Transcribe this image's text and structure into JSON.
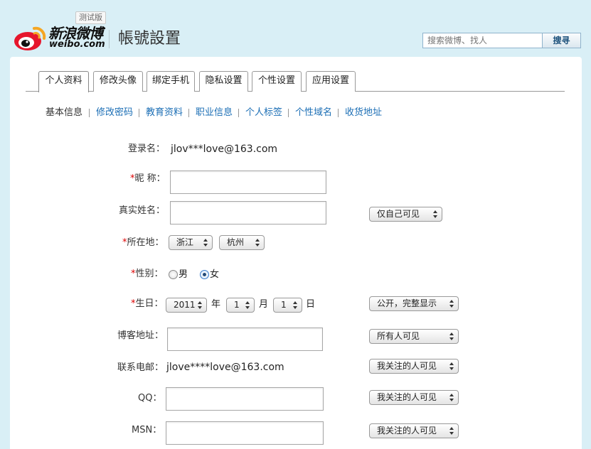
{
  "header": {
    "beta_badge": "测试版",
    "brand_cn": "新浪微博",
    "brand_en": "weibo.com",
    "page_title": "帳號設置",
    "search_placeholder": "搜索微博、找人",
    "search_button": "搜寻"
  },
  "tabs": [
    {
      "label": "个人资料",
      "active": true
    },
    {
      "label": "修改头像"
    },
    {
      "label": "绑定手机"
    },
    {
      "label": "隐私设置"
    },
    {
      "label": "个性设置"
    },
    {
      "label": "应用设置"
    }
  ],
  "subnav": [
    {
      "label": "基本信息",
      "current": true
    },
    {
      "label": "修改密码"
    },
    {
      "label": "教育资料"
    },
    {
      "label": "职业信息"
    },
    {
      "label": "个人标签"
    },
    {
      "label": "个性域名"
    },
    {
      "label": "收货地址"
    }
  ],
  "form": {
    "login_label": "登录名：",
    "login_value": "jlov***love@163.com",
    "required_mark": "*",
    "nickname_label": "昵 称：",
    "realname_label": "真实姓名：",
    "realname_privacy": "仅自己可见",
    "location_label": "所在地：",
    "province": "浙江",
    "city": "杭州",
    "gender_label": "性别：",
    "gender_male": "男",
    "gender_female": "女",
    "gender_selected": "女",
    "birthday_label": "生日：",
    "birth_year": "2011",
    "year_unit": "年",
    "birth_month": "1",
    "month_unit": "月",
    "birth_day": "1",
    "day_unit": "日",
    "birthday_privacy": "公开，完整显示",
    "blog_label": "博客地址：",
    "blog_privacy": "所有人可见",
    "email_label": "联系电邮：",
    "email_value": "jlove****love@163.com",
    "email_privacy": "我关注的人可见",
    "qq_label": "QQ：",
    "qq_privacy": "我关注的人可见",
    "msn_label": "MSN：",
    "msn_privacy": "我关注的人可见"
  },
  "colors": {
    "page_bg": "#d9eff6",
    "link": "#1b6eb5",
    "required": "#dd0000",
    "logo_red": "#e6162d",
    "logo_orange": "#f5a623"
  }
}
